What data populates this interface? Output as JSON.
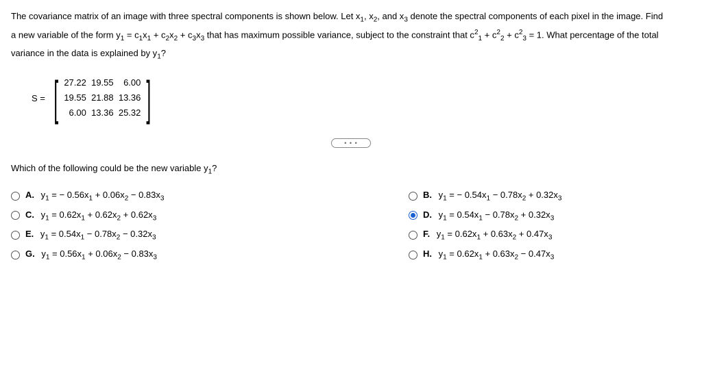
{
  "problem": {
    "p1a": "The covariance matrix of an image with three spectral components is shown below. Let x",
    "p1b": ", x",
    "p1c": ", and x",
    "p1d": " denote the spectral components of each pixel in the image. Find",
    "p2a": "a new variable of the form y",
    "p2b": " = c",
    "p2c": "x",
    "p2d": " + c",
    "p2e": "x",
    "p2f": " + c",
    "p2g": "x",
    "p2h": " that has maximum possible variance, subject to the constraint that c",
    "p2i": " + c",
    "p2j": " + c",
    "p2k": " = 1. What percentage of the total",
    "p3a": "variance in the data is explained by y",
    "p3b": "?"
  },
  "matrix": {
    "label": "S =",
    "row1": "27.22  19.55    6.00",
    "row2": "19.55  21.88  13.36",
    "row3": "  6.00  13.36  25.32"
  },
  "divider": "• • •",
  "q2a": "Which of the following could be the new variable y",
  "q2b": "?",
  "options": {
    "A": {
      "letter": "A.",
      "t1": "y",
      "t2": " = − 0.56x",
      "t3": " + 0.06x",
      "t4": " − 0.83x"
    },
    "B": {
      "letter": "B.",
      "t1": "y",
      "t2": " = − 0.54x",
      "t3": " − 0.78x",
      "t4": " + 0.32x"
    },
    "C": {
      "letter": "C.",
      "t1": "y",
      "t2": " = 0.62x",
      "t3": " + 0.62x",
      "t4": " + 0.62x"
    },
    "D": {
      "letter": "D.",
      "t1": "y",
      "t2": " = 0.54x",
      "t3": " − 0.78x",
      "t4": " + 0.32x"
    },
    "E": {
      "letter": "E.",
      "t1": "y",
      "t2": " = 0.54x",
      "t3": " − 0.78x",
      "t4": " − 0.32x"
    },
    "F": {
      "letter": "F.",
      "t1": "y",
      "t2": " = 0.62x",
      "t3": " + 0.63x",
      "t4": " + 0.47x"
    },
    "G": {
      "letter": "G.",
      "t1": "y",
      "t2": " = 0.56x",
      "t3": " + 0.06x",
      "t4": " − 0.83x"
    },
    "H": {
      "letter": "H.",
      "t1": "y",
      "t2": " = 0.62x",
      "t3": " + 0.63x",
      "t4": " − 0.47x"
    }
  },
  "selected": "D"
}
